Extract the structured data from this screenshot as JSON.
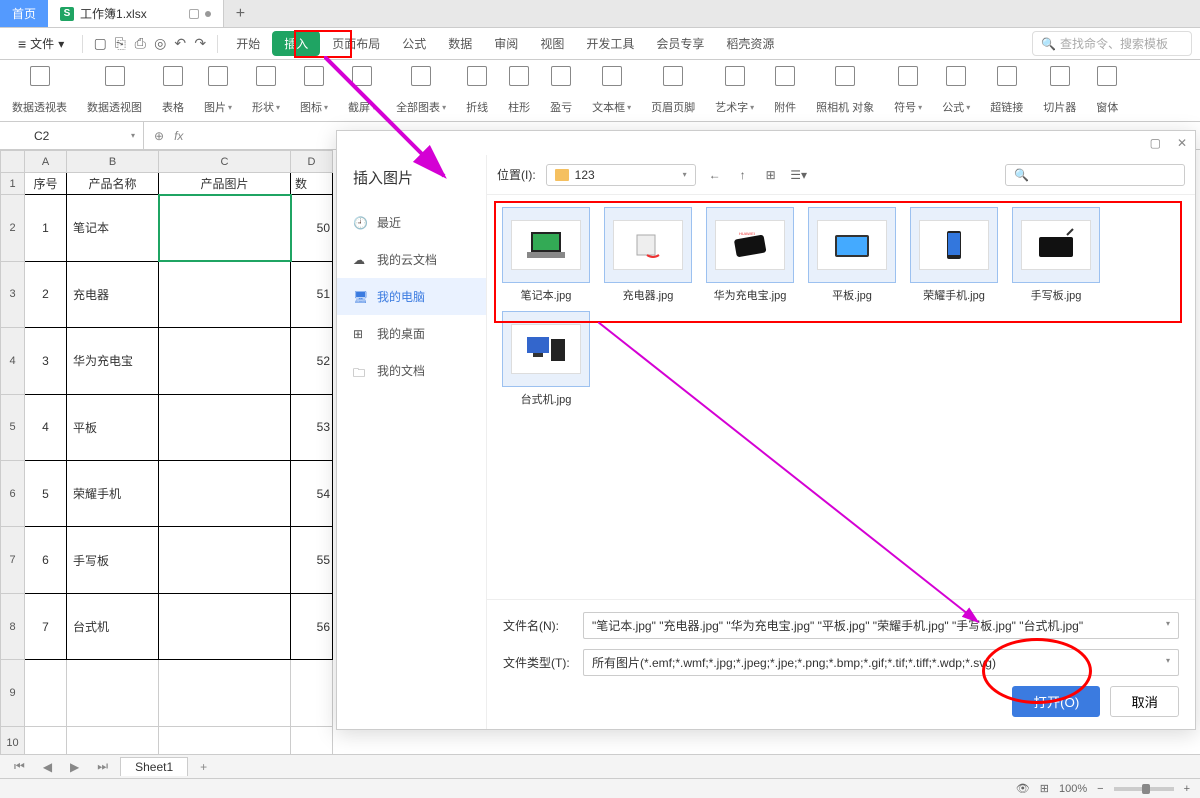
{
  "tabs": {
    "home": "首页",
    "file": "工作簿1.xlsx"
  },
  "menubar": {
    "file": "文件",
    "chev": "▾",
    "tabs": [
      "开始",
      "插入",
      "页面布局",
      "公式",
      "数据",
      "审阅",
      "视图",
      "开发工具",
      "会员专享",
      "稻壳资源"
    ],
    "active_index": 1,
    "search_placeholder": "查找命令、搜索模板"
  },
  "ribbon": [
    {
      "label": "数据透视表"
    },
    {
      "label": "数据透视图"
    },
    {
      "label": "表格"
    },
    {
      "label": "图片",
      "chev": true
    },
    {
      "label": "形状",
      "chev": true
    },
    {
      "label": "图标",
      "chev": true
    },
    {
      "label": "截屏",
      "chev": true
    },
    {
      "label": "全部图表",
      "chev": true
    },
    {
      "label": "折线"
    },
    {
      "label": "柱形"
    },
    {
      "label": "盈亏"
    },
    {
      "label": "文本框",
      "chev": true
    },
    {
      "label": "页眉页脚"
    },
    {
      "label": "艺术字",
      "chev": true
    },
    {
      "label": "附件"
    },
    {
      "label": "照相机 对象",
      "stacked": true
    },
    {
      "label": "符号",
      "chev": true
    },
    {
      "label": "公式",
      "chev": true
    },
    {
      "label": "超链接"
    },
    {
      "label": "切片器"
    },
    {
      "label": "窗体"
    }
  ],
  "namebox": "C2",
  "fx": "fx",
  "sheet": {
    "cols": [
      "A",
      "B",
      "C",
      "D"
    ],
    "header": [
      "序号",
      "产品名称",
      "产品图片",
      "数"
    ],
    "rows": [
      {
        "n": "1",
        "name": "笔记本",
        "val": "50"
      },
      {
        "n": "2",
        "name": "充电器",
        "val": "51"
      },
      {
        "n": "3",
        "name": "华为充电宝",
        "val": "52"
      },
      {
        "n": "4",
        "name": "平板",
        "val": "53"
      },
      {
        "n": "5",
        "name": "荣耀手机",
        "val": "54"
      },
      {
        "n": "6",
        "name": "手写板",
        "val": "55"
      },
      {
        "n": "7",
        "name": "台式机",
        "val": "56"
      }
    ]
  },
  "dialog": {
    "title": "插入图片",
    "sidebar": [
      {
        "icon": "clock",
        "label": "最近"
      },
      {
        "icon": "cloud",
        "label": "我的云文档"
      },
      {
        "icon": "monitor",
        "label": "我的电脑",
        "active": true
      },
      {
        "icon": "desktop",
        "label": "我的桌面"
      },
      {
        "icon": "folder",
        "label": "我的文档"
      }
    ],
    "location_label": "位置(I):",
    "location_value": "123",
    "thumbs": [
      "笔记本.jpg",
      "充电器.jpg",
      "华为充电宝.jpg",
      "平板.jpg",
      "荣耀手机.jpg",
      "手写板.jpg",
      "台式机.jpg"
    ],
    "filename_label": "文件名(N):",
    "filename_value": "\"笔记本.jpg\" \"充电器.jpg\" \"华为充电宝.jpg\" \"平板.jpg\" \"荣耀手机.jpg\" \"手写板.jpg\" \"台式机.jpg\"",
    "filetype_label": "文件类型(T):",
    "filetype_value": "所有图片(*.emf;*.wmf;*.jpg;*.jpeg;*.jpe;*.png;*.bmp;*.gif;*.tif;*.tiff;*.wdp;*.svg)",
    "open_btn": "打开(O)",
    "cancel_btn": "取消"
  },
  "sheet_tab": "Sheet1",
  "zoom": "100%"
}
